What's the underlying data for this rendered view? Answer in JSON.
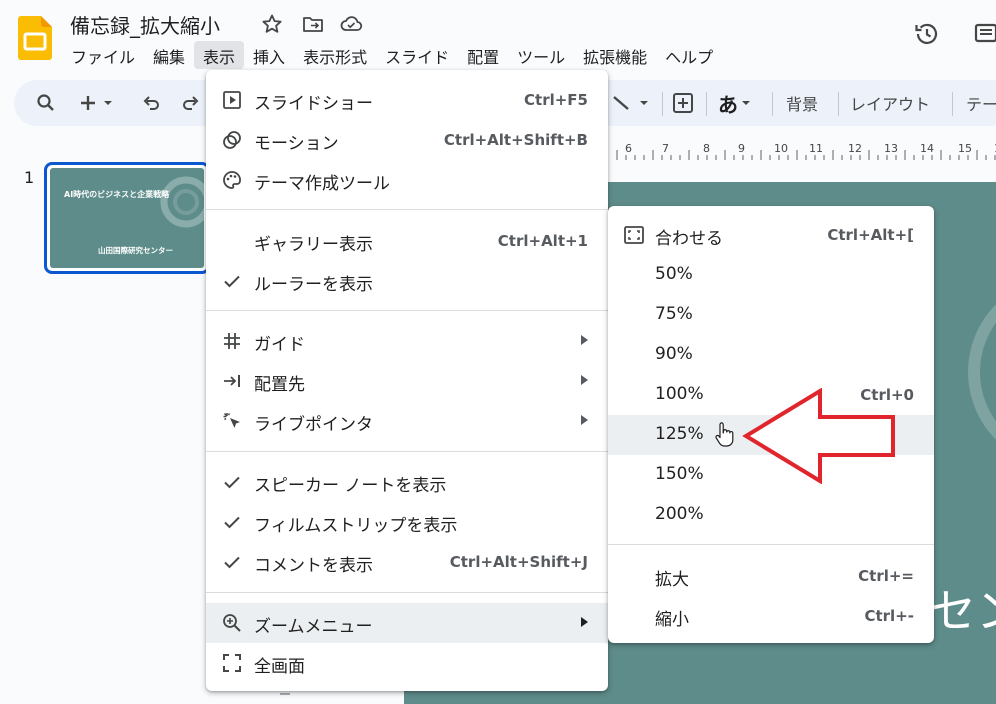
{
  "document": {
    "title": "備忘録_拡大縮小",
    "brand_color": "#fbbc04",
    "slide_color": "#5e8c8a",
    "accent": "#0b57d0",
    "annotation_color": "#e0262c"
  },
  "menubar": {
    "items": [
      "ファイル",
      "編集",
      "表示",
      "挿入",
      "表示形式",
      "スライド",
      "配置",
      "ツール",
      "拡張機能",
      "ヘルプ"
    ],
    "active": "表示"
  },
  "toolbar": {
    "text_style_label": "あ",
    "background_label": "背景",
    "layout_label": "レイアウト",
    "theme_label": "テー"
  },
  "ruler": {
    "numbers": [
      "6",
      "7",
      "8",
      "9",
      "10",
      "11",
      "12",
      "13",
      "14",
      "15",
      "16"
    ]
  },
  "filmstrip": {
    "slide_number": "1",
    "thumb_title": "AI時代のビジネスと企業戦略",
    "thumb_subtitle": "山田国際研究センター"
  },
  "slide": {
    "visible_text": "セン"
  },
  "view_menu": {
    "items": [
      {
        "label": "スライドショー",
        "shortcut": "Ctrl+F5",
        "icon": "slideshow-icon"
      },
      {
        "label": "モーション",
        "shortcut": "Ctrl+Alt+Shift+B",
        "icon": "motion-icon"
      },
      {
        "label": "テーマ作成ツール",
        "shortcut": "",
        "icon": "palette-icon"
      },
      {
        "label": "ギャラリー表示",
        "shortcut": "Ctrl+Alt+1",
        "icon": ""
      },
      {
        "label": "ルーラーを表示",
        "shortcut": "",
        "icon": "check-icon"
      },
      {
        "label": "ガイド",
        "shortcut": "",
        "icon": "grid-icon",
        "submenu": true
      },
      {
        "label": "配置先",
        "shortcut": "",
        "icon": "snap-icon",
        "submenu": true
      },
      {
        "label": "ライブポインタ",
        "shortcut": "",
        "icon": "pointer-icon",
        "submenu": true
      },
      {
        "label": "スピーカー ノートを表示",
        "shortcut": "",
        "icon": "check-icon"
      },
      {
        "label": "フィルムストリップを表示",
        "shortcut": "",
        "icon": "check-icon"
      },
      {
        "label": "コメントを表示",
        "shortcut": "Ctrl+Alt+Shift+J",
        "icon": "check-icon"
      },
      {
        "label": "ズームメニュー",
        "shortcut": "",
        "icon": "zoom-in-icon",
        "submenu": true,
        "highlighted": true
      },
      {
        "label": "全画面",
        "shortcut": "",
        "icon": "fullscreen-icon"
      }
    ]
  },
  "zoom_menu": {
    "items": [
      {
        "label": "合わせる",
        "shortcut": "Ctrl+Alt+[",
        "icon": "fit-icon"
      },
      {
        "label": "50%",
        "shortcut": ""
      },
      {
        "label": "75%",
        "shortcut": ""
      },
      {
        "label": "90%",
        "shortcut": ""
      },
      {
        "label": "100%",
        "shortcut": "Ctrl+0"
      },
      {
        "label": "125%",
        "shortcut": "",
        "highlighted": true
      },
      {
        "label": "150%",
        "shortcut": ""
      },
      {
        "label": "200%",
        "shortcut": ""
      },
      {
        "label": "拡大",
        "shortcut": "Ctrl+="
      },
      {
        "label": "縮小",
        "shortcut": "Ctrl+-"
      }
    ]
  }
}
